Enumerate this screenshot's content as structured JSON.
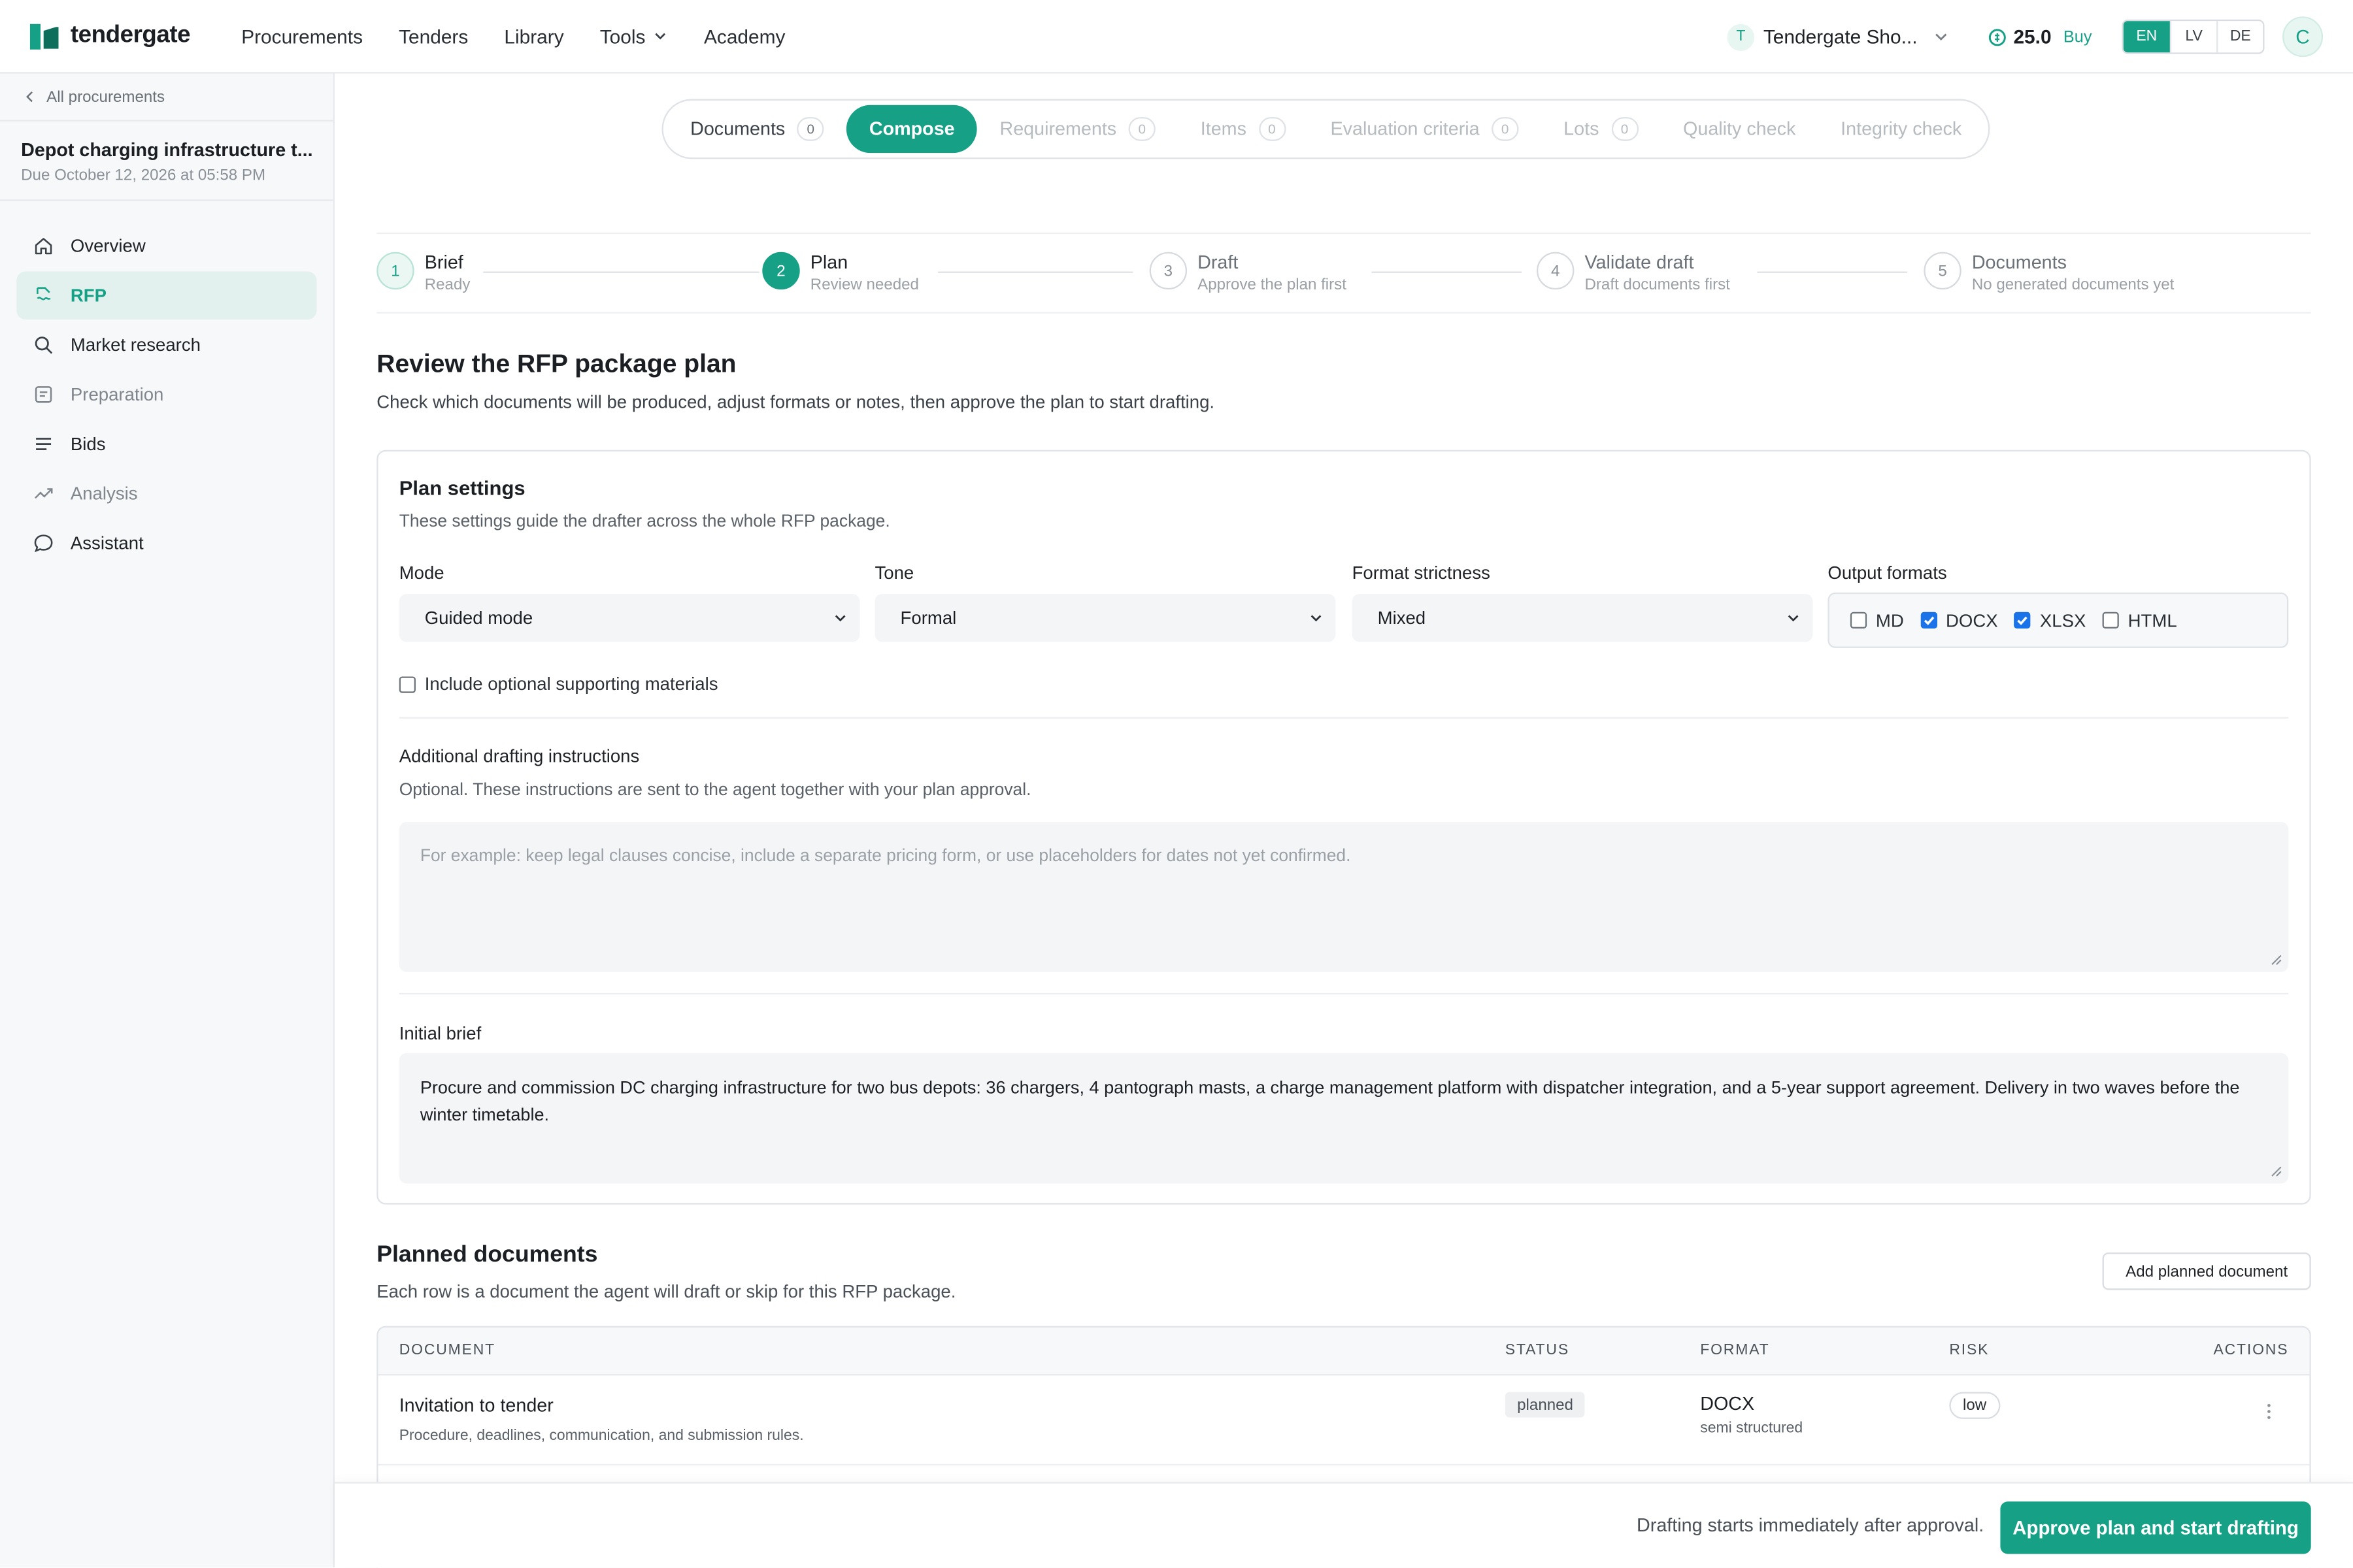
{
  "app": {
    "logo_text": "tendergate",
    "nav": [
      {
        "label": "Procurements"
      },
      {
        "label": "Tenders"
      },
      {
        "label": "Library"
      },
      {
        "label": "Tools"
      },
      {
        "label": "Academy"
      }
    ],
    "org_initial": "T",
    "org_name": "Tendergate Sho...",
    "credits": "25.0",
    "buy_label": "Buy",
    "languages": [
      "EN",
      "LV",
      "DE"
    ],
    "active_language": "EN",
    "avatar_initial": "C",
    "accent_color": "#16a187"
  },
  "sidebar": {
    "back_label": "All procurements",
    "project_title": "Depot charging infrastructure t...",
    "project_due": "Due October 12, 2026 at 05:58 PM",
    "items": [
      {
        "label": "Overview",
        "icon": "home-icon"
      },
      {
        "label": "RFP",
        "icon": "document-sign-icon"
      },
      {
        "label": "Market research",
        "icon": "search-icon"
      },
      {
        "label": "Preparation",
        "icon": "clipboard-icon"
      },
      {
        "label": "Bids",
        "icon": "list-icon"
      },
      {
        "label": "Analysis",
        "icon": "trend-icon"
      },
      {
        "label": "Assistant",
        "icon": "chat-icon"
      }
    ]
  },
  "tabs": [
    {
      "label": "Documents",
      "count": "0"
    },
    {
      "label": "Compose"
    },
    {
      "label": "Requirements",
      "count": "0"
    },
    {
      "label": "Items",
      "count": "0"
    },
    {
      "label": "Evaluation criteria",
      "count": "0"
    },
    {
      "label": "Lots",
      "count": "0"
    },
    {
      "label": "Quality check"
    },
    {
      "label": "Integrity check"
    }
  ],
  "steps": [
    {
      "num": "1",
      "name": "Brief",
      "sub": "Ready"
    },
    {
      "num": "2",
      "name": "Plan",
      "sub": "Review needed"
    },
    {
      "num": "3",
      "name": "Draft",
      "sub": "Approve the plan first"
    },
    {
      "num": "4",
      "name": "Validate draft",
      "sub": "Draft documents first"
    },
    {
      "num": "5",
      "name": "Documents",
      "sub": "No generated documents yet"
    }
  ],
  "review": {
    "title": "Review the RFP package plan",
    "subtitle": "Check which documents will be produced, adjust formats or notes, then approve the plan to start drafting."
  },
  "plan_settings": {
    "title": "Plan settings",
    "subtitle": "These settings guide the drafter across the whole RFP package.",
    "mode_label": "Mode",
    "mode_value": "Guided mode",
    "tone_label": "Tone",
    "tone_value": "Formal",
    "strictness_label": "Format strictness",
    "strictness_value": "Mixed",
    "formats_label": "Output formats",
    "formats": [
      {
        "label": "MD",
        "checked": false
      },
      {
        "label": "DOCX",
        "checked": true
      },
      {
        "label": "XLSX",
        "checked": true
      },
      {
        "label": "HTML",
        "checked": false
      }
    ],
    "optional_label": "Include optional supporting materials",
    "instructions_label": "Additional drafting instructions",
    "instructions_sub": "Optional. These instructions are sent to the agent together with your plan approval.",
    "instructions_placeholder": "For example: keep legal clauses concise, include a separate pricing form, or use placeholders for dates not yet confirmed.",
    "brief_label": "Initial brief",
    "brief_value": "Procure and commission DC charging infrastructure for two bus depots: 36 chargers, 4 pantograph masts, a charge management platform with dispatcher integration, and a 5-year support agreement. Delivery in two waves before the winter timetable."
  },
  "planned": {
    "title": "Planned documents",
    "subtitle": "Each row is a document the agent will draft or skip for this RFP package.",
    "add_label": "Add planned document",
    "columns": [
      "DOCUMENT",
      "STATUS",
      "FORMAT",
      "RISK",
      "ACTIONS"
    ],
    "rows": [
      {
        "name": "Invitation to tender",
        "desc": "Procedure, deadlines, communication, and submission rules.",
        "status": "planned",
        "format": "DOCX",
        "format_sub": "semi structured",
        "risk": "low"
      }
    ]
  },
  "footer": {
    "note": "Drafting starts immediately after approval.",
    "approve_label": "Approve plan and start drafting"
  }
}
